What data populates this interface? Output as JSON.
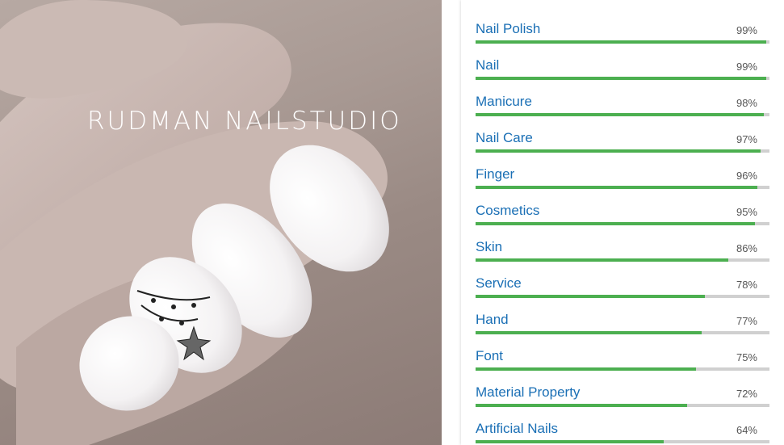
{
  "photo": {
    "watermark": "RUDMAN NAILSTUDIO"
  },
  "labels": [
    {
      "name": "Nail Polish",
      "score": "99%",
      "value": 0.99
    },
    {
      "name": "Nail",
      "score": "99%",
      "value": 0.99
    },
    {
      "name": "Manicure",
      "score": "98%",
      "value": 0.98
    },
    {
      "name": "Nail Care",
      "score": "97%",
      "value": 0.97
    },
    {
      "name": "Finger",
      "score": "96%",
      "value": 0.96
    },
    {
      "name": "Cosmetics",
      "score": "95%",
      "value": 0.95
    },
    {
      "name": "Skin",
      "score": "86%",
      "value": 0.86
    },
    {
      "name": "Service",
      "score": "78%",
      "value": 0.78
    },
    {
      "name": "Hand",
      "score": "77%",
      "value": 0.77
    },
    {
      "name": "Font",
      "score": "75%",
      "value": 0.75
    },
    {
      "name": "Material Property",
      "score": "72%",
      "value": 0.72
    },
    {
      "name": "Artificial Nails",
      "score": "64%",
      "value": 0.64
    }
  ],
  "colors": {
    "bar_fill": "#4caf50",
    "bar_track": "#d0d0d0",
    "label_text": "#1a6fb5"
  }
}
